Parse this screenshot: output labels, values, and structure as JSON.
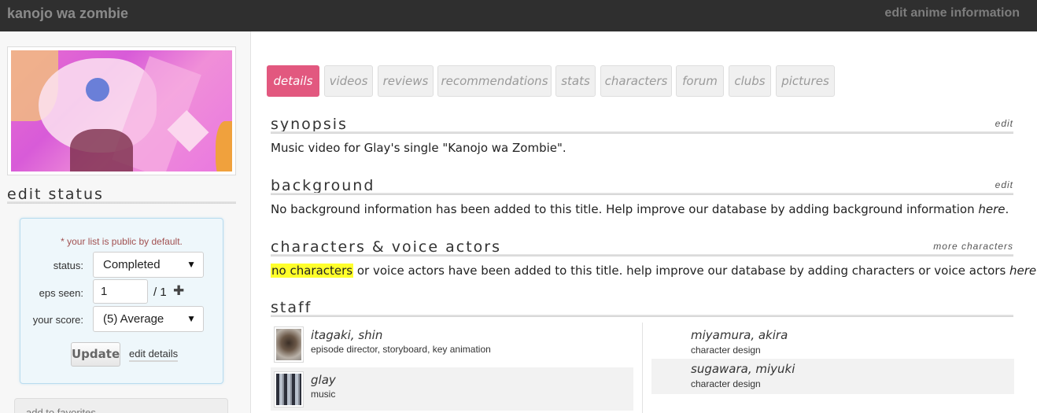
{
  "header": {
    "title": "kanojo wa zombie",
    "edit_link": "edit anime information"
  },
  "sidebar": {
    "edit_status_heading": "edit status",
    "status_box": {
      "note": "* your list is public by default.",
      "status_label": "status:",
      "status_value": "Completed",
      "eps_label": "eps seen:",
      "eps_value": "1",
      "eps_total": "/ 1",
      "score_label": "your score:",
      "score_value": "(5) Average",
      "update_label": "Update",
      "edit_details_label": "edit details"
    },
    "favorites_label": "add to favorites"
  },
  "tabs": [
    {
      "label": "details",
      "active": true
    },
    {
      "label": "videos",
      "active": false
    },
    {
      "label": "reviews",
      "active": false
    },
    {
      "label": "recommendations",
      "active": false
    },
    {
      "label": "stats",
      "active": false
    },
    {
      "label": "characters",
      "active": false
    },
    {
      "label": "forum",
      "active": false
    },
    {
      "label": "clubs",
      "active": false
    },
    {
      "label": "pictures",
      "active": false
    }
  ],
  "synopsis": {
    "heading": "synopsis",
    "edit": "edit",
    "text": "Music video for Glay's single \"Kanojo wa Zombie\"."
  },
  "background": {
    "heading": "background",
    "edit": "edit",
    "text": "No background information has been added to this title. Help improve our database by adding background information ",
    "link": "here",
    "end": "."
  },
  "characters": {
    "heading": "characters & voice actors",
    "more": "more characters",
    "highlight": "no characters",
    "text": " or voice actors have been added to this title. help improve our database by adding characters or voice actors ",
    "link": "here",
    "end": "."
  },
  "staff": {
    "heading": "staff",
    "left": [
      {
        "name": "itagaki, shin",
        "role": "episode director, storyboard, key animation"
      },
      {
        "name": "glay",
        "role": "music"
      }
    ],
    "right": [
      {
        "name": "miyamura, akira",
        "role": "character design"
      },
      {
        "name": "sugawara, miyuki",
        "role": "character design"
      }
    ]
  },
  "colors": {
    "accent": "#e2587f",
    "header_bg": "#2f2f2f",
    "highlight": "#ffff2b",
    "status_box_bg": "#eef7fb"
  }
}
